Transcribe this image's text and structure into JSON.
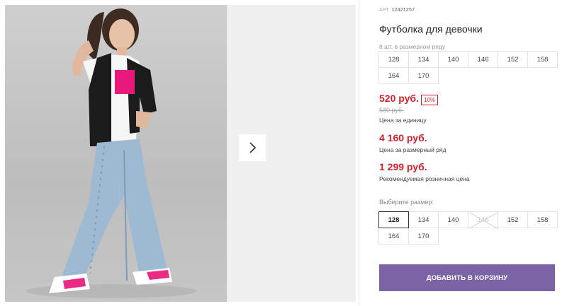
{
  "product": {
    "article_label": "АРТ.",
    "article": "12421257",
    "title": "Футболка для девочки",
    "pack_note": "8 шт. в размерном ряду",
    "pack_sizes": [
      "128",
      "134",
      "140",
      "146",
      "152",
      "158",
      "164",
      "170"
    ]
  },
  "prices": {
    "unit_price": "520 руб.",
    "discount": "10%",
    "old_price": "580 руб.",
    "unit_caption": "Цена за единицу",
    "row_price": "4 160 руб.",
    "row_caption": "Цена за размерный ряд",
    "retail_price": "1 299 руб.",
    "retail_caption": "Рекомендуемая розничная цена"
  },
  "size_picker": {
    "label": "Выберите размер:",
    "sizes": [
      "128",
      "134",
      "140",
      "146",
      "152",
      "158",
      "164",
      "170"
    ],
    "selected": "128",
    "unavailable": [
      "146"
    ]
  },
  "cart_button": "ДОБАВИТЬ В КОРЗИНУ",
  "gallery": {
    "next_icon": "chevron-right-icon"
  },
  "colors": {
    "price_red": "#d4202a",
    "accent_purple": "#7b63a6"
  }
}
